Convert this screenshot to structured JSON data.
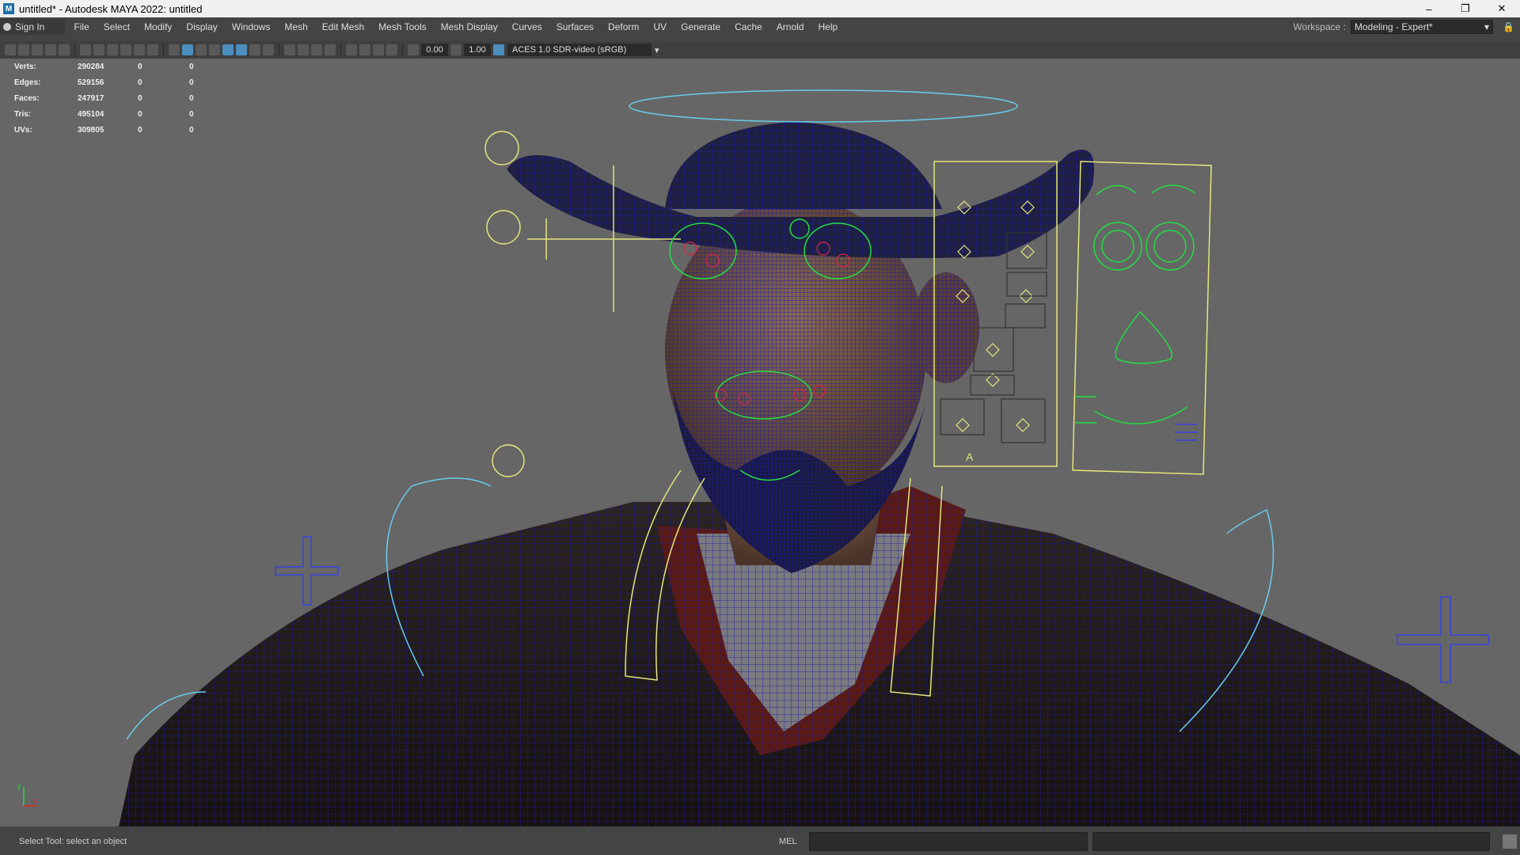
{
  "window": {
    "title": "untitled* - Autodesk MAYA 2022: untitled",
    "app_icon": "M",
    "minimize": "–",
    "restore": "❐",
    "close": "✕"
  },
  "menubar": {
    "signin_label": "Sign In",
    "items": [
      "File",
      "Select",
      "Modify",
      "Display",
      "Windows",
      "Mesh",
      "Edit Mesh",
      "Mesh Tools",
      "Mesh Display",
      "Curves",
      "Surfaces",
      "Deform",
      "UV",
      "Generate",
      "Cache",
      "Arnold",
      "Help"
    ],
    "workspace_label": "Workspace :",
    "workspace_value": "Modeling - Expert*"
  },
  "toolbar": {
    "near_clip": "0.00",
    "far_clip": "1.00",
    "color_space": "ACES 1.0 SDR-video (sRGB)"
  },
  "hud": {
    "rows": [
      {
        "label": "Verts:",
        "v1": "290284",
        "v2": "0",
        "v3": "0"
      },
      {
        "label": "Edges:",
        "v1": "529156",
        "v2": "0",
        "v3": "0"
      },
      {
        "label": "Faces:",
        "v1": "247917",
        "v2": "0",
        "v3": "0"
      },
      {
        "label": "Tris:",
        "v1": "495104",
        "v2": "0",
        "v3": "0"
      },
      {
        "label": "UVs:",
        "v1": "309805",
        "v2": "0",
        "v3": "0"
      }
    ]
  },
  "viewport": {
    "camera": "persp",
    "rig_letter": "A",
    "axis_y": "y",
    "axis_x": "x"
  },
  "statusbar": {
    "help_text": "Select Tool: select an object",
    "mel_label": "MEL"
  },
  "colors": {
    "wireframe": "#1a1aa8",
    "control_yellow": "#e6e67a",
    "control_green": "#22dd44",
    "control_cyan": "#66ccee"
  }
}
